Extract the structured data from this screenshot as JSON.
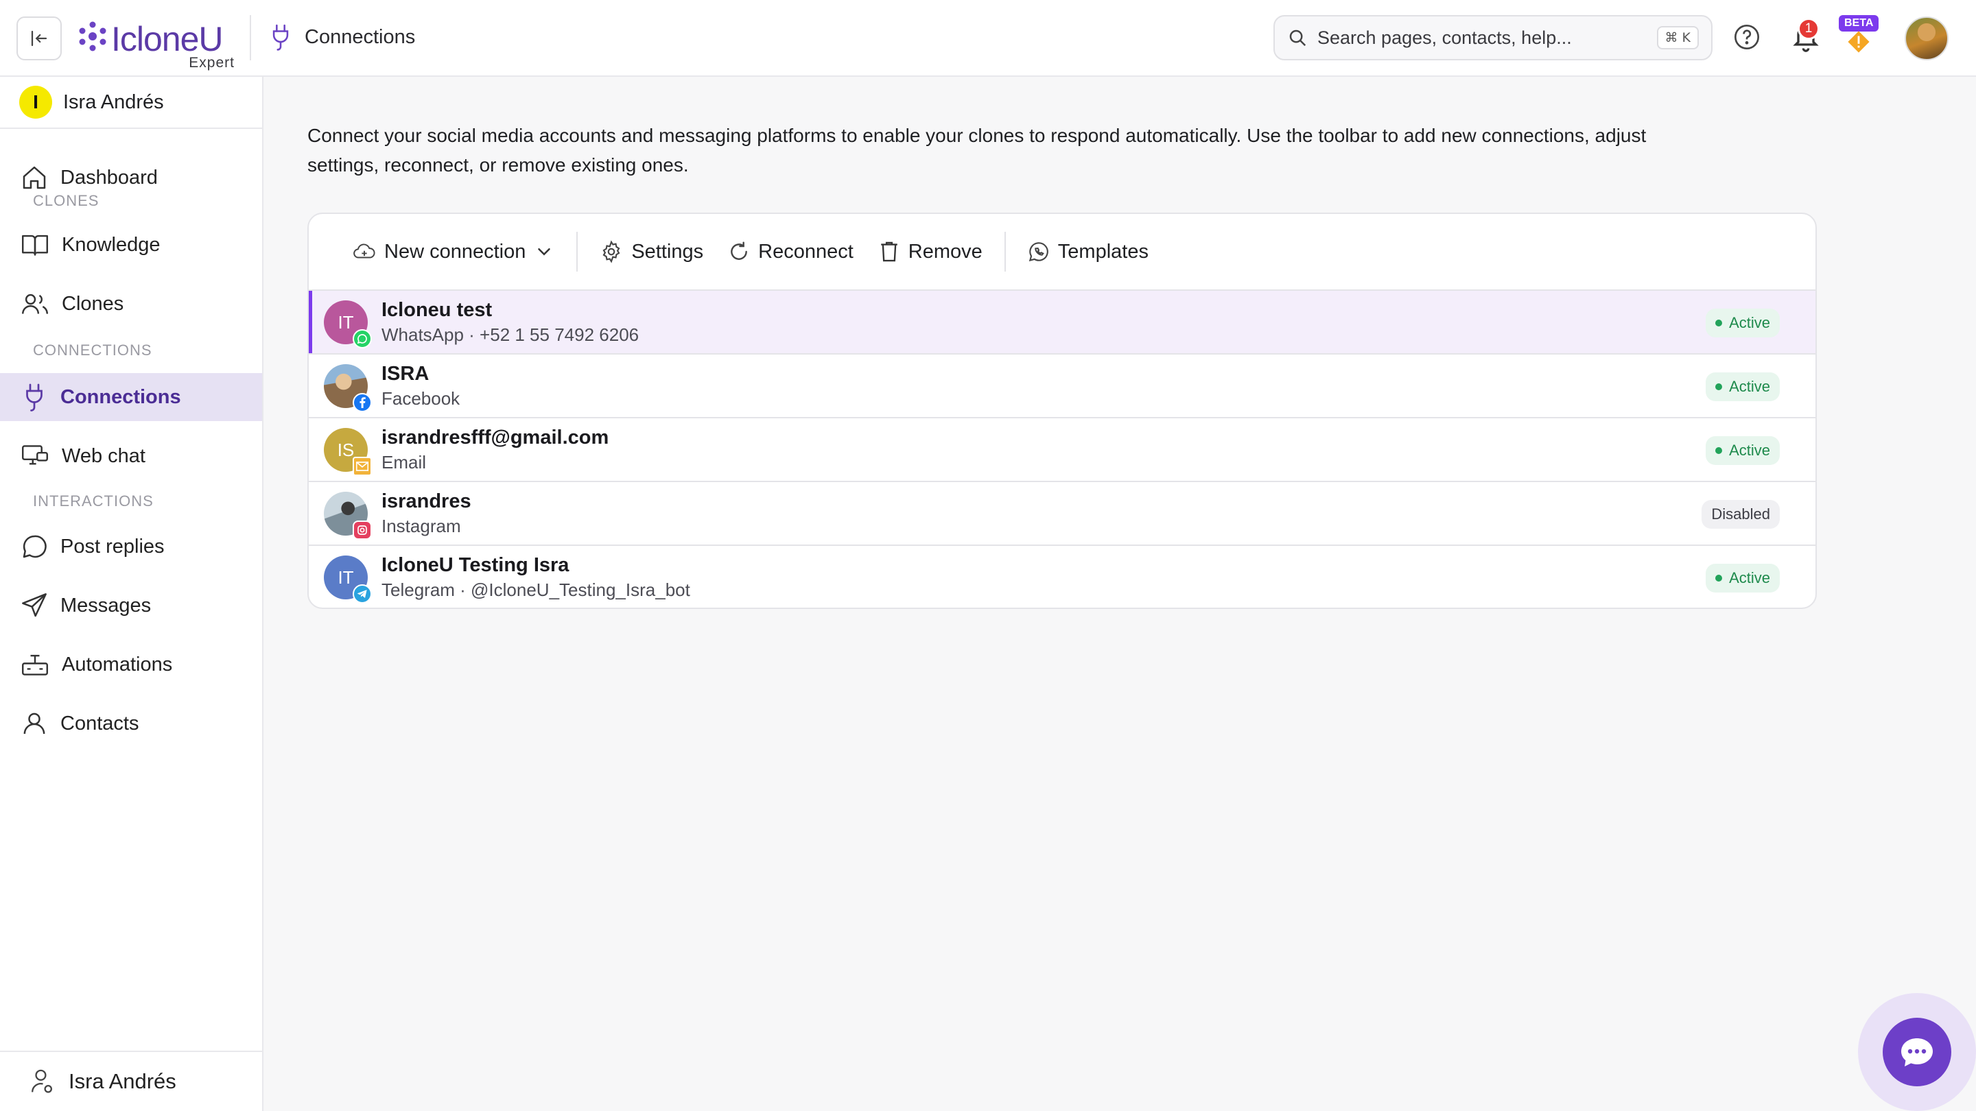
{
  "app": {
    "brand": "IcloneU",
    "brand_sub": "Expert",
    "page_title": "Connections",
    "brand_color": "#5b3aa6",
    "accent_color": "#7c3aed"
  },
  "search": {
    "placeholder": "Search pages, contacts, help...",
    "shortcut": "⌘ K"
  },
  "header": {
    "notification_count": "1",
    "beta_label": "BETA"
  },
  "sidebar": {
    "user_initial": "I",
    "user_name": "Isra Andrés",
    "items": [
      {
        "label": "Dashboard",
        "icon": "home-icon"
      },
      {
        "label": "Knowledge",
        "icon": "book-icon"
      },
      {
        "label": "Clones",
        "icon": "users-icon"
      },
      {
        "label": "Connections",
        "icon": "plug-icon",
        "active": true
      },
      {
        "label": "Web chat",
        "icon": "monitor-chat-icon"
      },
      {
        "label": "Post replies",
        "icon": "speech-bubble-icon"
      },
      {
        "label": "Messages",
        "icon": "send-icon"
      },
      {
        "label": "Automations",
        "icon": "automation-icon"
      },
      {
        "label": "Contacts",
        "icon": "person-icon"
      }
    ],
    "sections": [
      "CLONES",
      "CONNECTIONS",
      "INTERACTIONS"
    ],
    "footer_name": "Isra Andrés"
  },
  "main": {
    "intro": "Connect your social media accounts and messaging platforms to enable your clones to respond automatically. Use the toolbar to add new connections, adjust settings, reconnect, or remove existing ones.",
    "toolbar": {
      "new_connection": "New connection",
      "settings": "Settings",
      "reconnect": "Reconnect",
      "remove": "Remove",
      "templates": "Templates"
    },
    "connections": [
      {
        "initials": "IT",
        "name": "Icloneu test",
        "detail": "WhatsApp · +52 1 55 7492 6206",
        "status": "Active",
        "channel": "whatsapp-icon",
        "avatar_color": "#b9579c",
        "selected": true
      },
      {
        "initials": "",
        "name": "ISRA",
        "detail": "Facebook",
        "status": "Active",
        "channel": "facebook-icon",
        "avatar_color": "#8a6a4a"
      },
      {
        "initials": "IS",
        "name": "israndresfff@gmail.com",
        "detail": "Email",
        "status": "Active",
        "channel": "email-icon",
        "avatar_color": "#c6a93f"
      },
      {
        "initials": "",
        "name": "israndres",
        "detail": "Instagram",
        "status": "Disabled",
        "channel": "instagram-icon",
        "avatar_color": "#7d8f9a"
      },
      {
        "initials": "IT",
        "name": "IcloneU Testing Isra",
        "detail": "Telegram · @IcloneU_Testing_Isra_bot",
        "status": "Active",
        "channel": "telegram-icon",
        "avatar_color": "#5a7cc8"
      }
    ]
  }
}
